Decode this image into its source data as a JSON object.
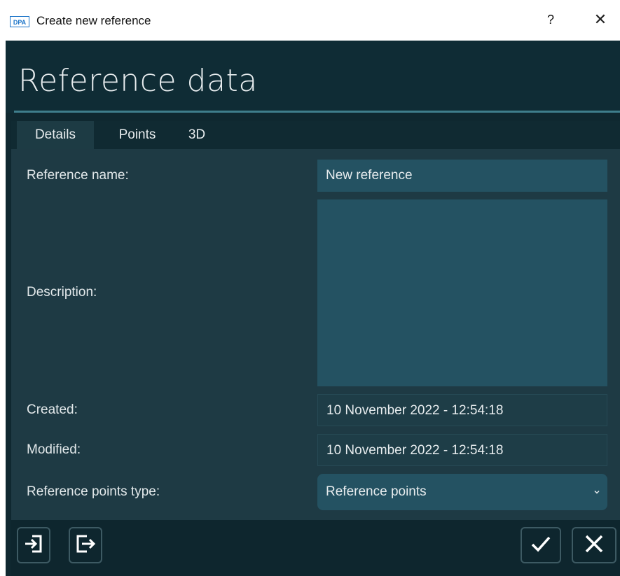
{
  "window": {
    "logo_text": "DPA",
    "title": "Create new reference",
    "help_label": "?",
    "close_label": "✕"
  },
  "header": {
    "title": "Reference data"
  },
  "tabs": [
    {
      "label": "Details",
      "active": true
    },
    {
      "label": "Points",
      "active": false
    },
    {
      "label": "3D",
      "active": false
    }
  ],
  "form": {
    "name_label": "Reference name:",
    "name_value": "New reference",
    "description_label": "Description:",
    "description_value": "",
    "created_label": "Created:",
    "created_value": "10 November 2022 - 12:54:18",
    "modified_label": "Modified:",
    "modified_value": "10 November 2022 - 12:54:18",
    "points_type_label": "Reference points type:",
    "points_type_value": "Reference points"
  },
  "footer": {
    "import_icon": "import-icon",
    "export_icon": "export-icon",
    "ok_icon": "checkmark-icon",
    "cancel_icon": "close-icon"
  },
  "colors": {
    "dialog_bg": "#0f2830",
    "panel_bg": "#1e3a44",
    "input_bg": "#245262",
    "accent_line": "#3f7e8c",
    "text": "#e7ecee"
  }
}
